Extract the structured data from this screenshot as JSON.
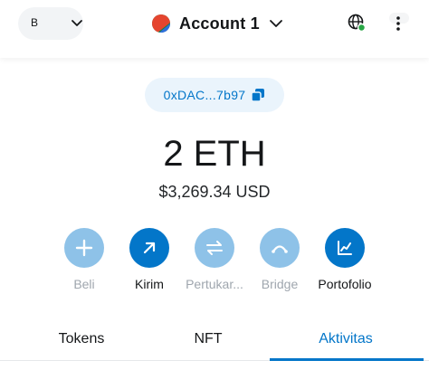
{
  "header": {
    "network_letter": "B",
    "account_name": "Account 1"
  },
  "address": {
    "short": "0xDAC...7b97"
  },
  "balance": {
    "amount": "2 ETH",
    "fiat": "$3,269.34 USD"
  },
  "actions": [
    {
      "label": "Beli",
      "icon": "plus-icon",
      "enabled": false
    },
    {
      "label": "Kirim",
      "icon": "arrow-up-right-icon",
      "enabled": true
    },
    {
      "label": "Pertukar...",
      "icon": "swap-arrows-icon",
      "enabled": false
    },
    {
      "label": "Bridge",
      "icon": "bridge-icon",
      "enabled": false
    },
    {
      "label": "Portofolio",
      "icon": "chart-line-icon",
      "enabled": true
    }
  ],
  "tabs": [
    {
      "label": "Tokens",
      "active": false
    },
    {
      "label": "NFT",
      "active": false
    },
    {
      "label": "Aktivitas",
      "active": true
    }
  ],
  "colors": {
    "accent": "#0376c9",
    "accent_light": "#8ec2e8",
    "address_bg": "#eaf4fc",
    "connected_dot": "#28a745"
  }
}
